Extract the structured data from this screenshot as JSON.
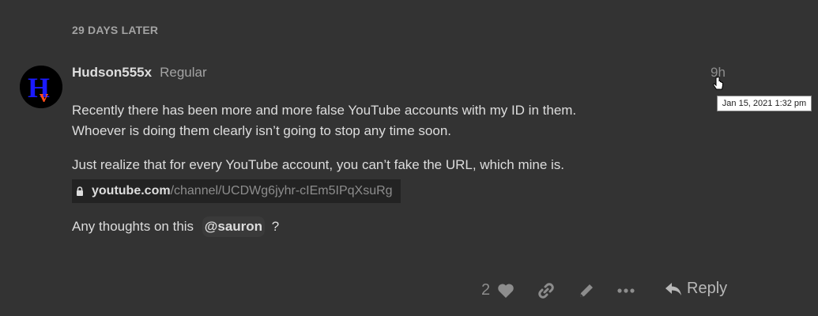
{
  "time_gap": {
    "label": "29 DAYS LATER"
  },
  "post": {
    "username": "Hudson555x",
    "user_title": "Regular",
    "relative_date": "9h",
    "tooltip": "Jan 15, 2021 1:32 pm",
    "paragraphs": [
      "Recently there has been more and more false YouTube accounts with my ID in them.",
      "Whoever is doing them clearly isn’t going to stop any time soon.",
      "Just realize that for every YouTube account, you can’t fake the URL, which mine is."
    ],
    "link": {
      "domain": "youtube.com",
      "path": "/channel/UCDWg6jyhr-cIEm5IPqXsuRg"
    },
    "question": {
      "before": "Any thoughts on this",
      "mention": "@sauron",
      "after": "?"
    }
  },
  "actions": {
    "like_count": "2",
    "reply_label": "Reply",
    "icons": [
      "heart-icon",
      "link-icon",
      "pencil-icon",
      "more-icon",
      "reply-icon"
    ]
  },
  "colors": {
    "background": "#333333",
    "text": "#dddddd",
    "muted": "#a3a3a3",
    "onebox_bg": "#232323"
  }
}
